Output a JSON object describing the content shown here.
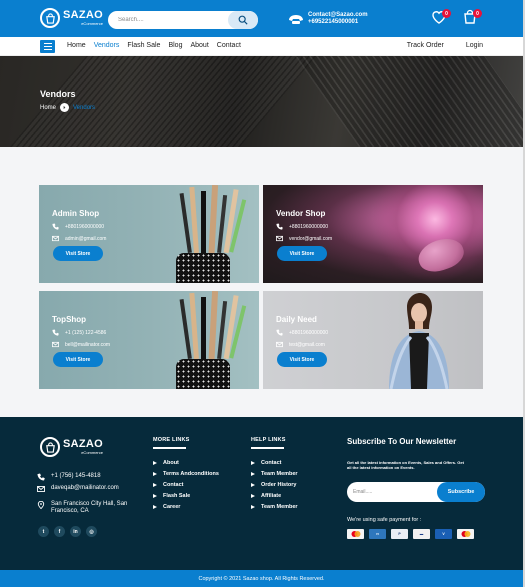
{
  "header": {
    "logo": {
      "brand": "SAZAO",
      "tagline": "eCommerce"
    },
    "search": {
      "placeholder": "Search...."
    },
    "contact": {
      "email": "Contact@Sazao.com",
      "phone": "+69522145000001"
    },
    "wishlist_count": "0",
    "cart_count": "0"
  },
  "nav": {
    "links": [
      "Home",
      "Vendors",
      "Flash Sale",
      "Blog",
      "About",
      "Contact"
    ],
    "active": "Vendors",
    "right": [
      "Track Order",
      "Login"
    ]
  },
  "hero": {
    "title": "Vendors",
    "breadcrumb": {
      "home": "Home",
      "current": "Vendors"
    }
  },
  "vendors": [
    {
      "name": "Admin Shop",
      "phone": "+8801960000000",
      "email": "admin@gmail.com",
      "button": "Visit Store"
    },
    {
      "name": "Vendor Shop",
      "phone": "+8801960000000",
      "email": "vendor@gmail.com",
      "button": "Visit Store"
    },
    {
      "name": "TopShop",
      "phone": "+1 (125) 122-4586",
      "email": "bell@mailinator.com",
      "button": "Visit Store"
    },
    {
      "name": "Daily Need",
      "phone": "+8801960000000",
      "email": "test@gmail.com",
      "button": "Visit Store"
    }
  ],
  "footer": {
    "logo": {
      "brand": "SAZAO",
      "tagline": "eCommerce"
    },
    "phone": "+1 (756) 145-4818",
    "email": "daveqab@mailinator.com",
    "address_line1": "San Francisco City Hall, San",
    "address_line2": "Francisco, CA",
    "socials": [
      "twitter-icon",
      "facebook-icon",
      "linkedin-icon",
      "instagram-icon"
    ],
    "more_links": {
      "title": "MORE LINKS",
      "items": [
        "About",
        "Terms Andconditions",
        "Contact",
        "Flash Sale",
        "Career"
      ]
    },
    "help_links": {
      "title": "HELP LINKS",
      "items": [
        "Contact",
        "Team Member",
        "Order History",
        "Affiliate",
        "Team Member"
      ]
    },
    "newsletter": {
      "title": "Subscribe To Our Newsletter",
      "subtitle": "Get all the latest information on Events, Sales and Offers. Get all the latest information on Events.",
      "placeholder": "Email.....",
      "button": "Subscribe",
      "safe_payment": "We're using safe payment for :"
    },
    "payments": [
      "Mastercard",
      "Amex",
      "PayPal",
      "Discover",
      "VISA",
      "Maestro"
    ],
    "copyright": "Copyright © 2021 Sazao shop. All Rights Reserved."
  },
  "colors": {
    "primary": "#0a7fcf",
    "footer_bg": "#062a3b",
    "badge": "#e8133a",
    "content_bg": "#f4f5f7"
  }
}
